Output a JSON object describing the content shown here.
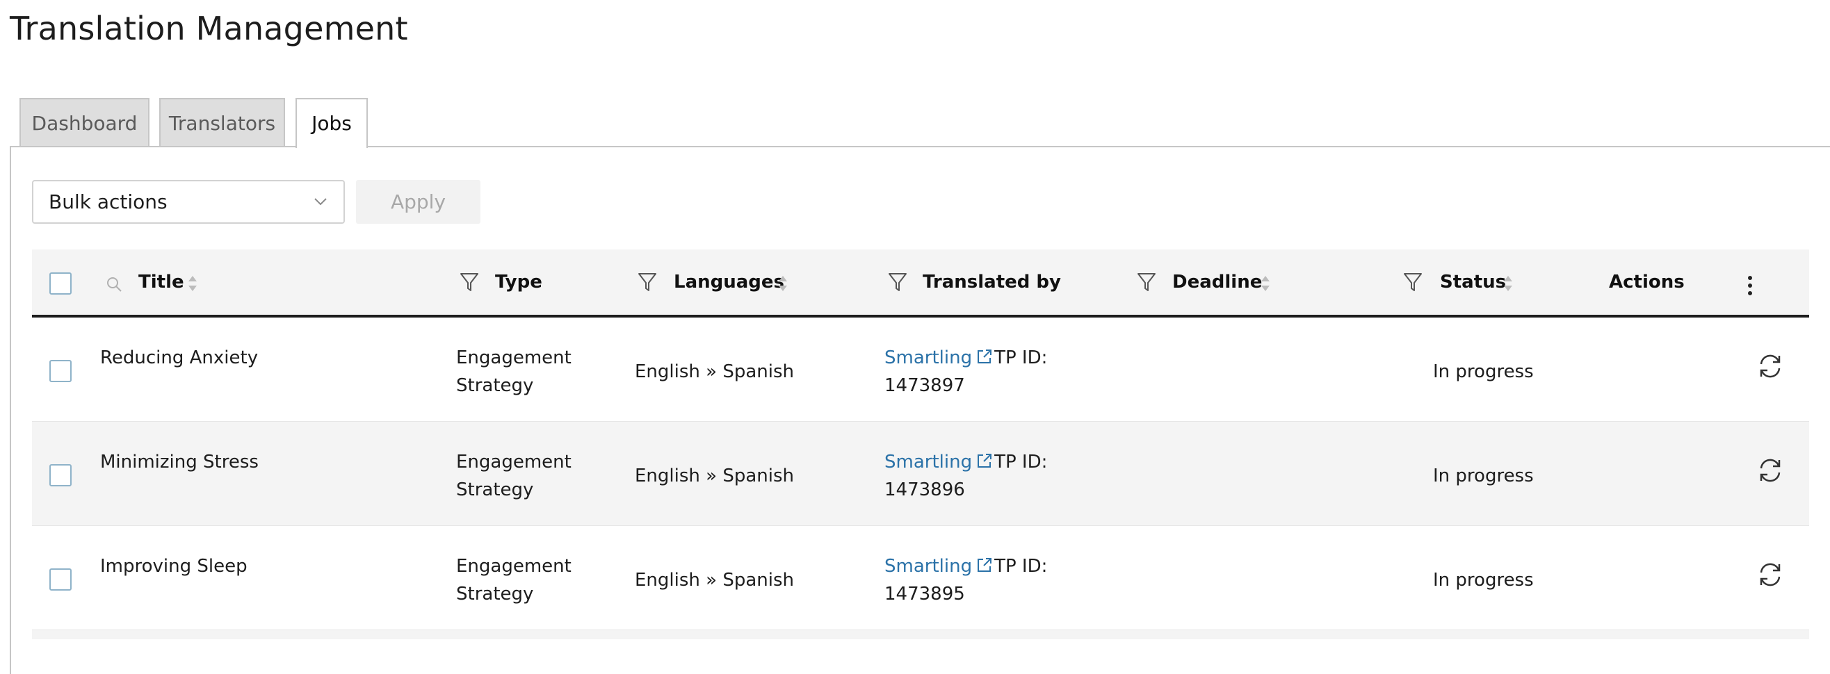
{
  "page": {
    "title": "Translation Management"
  },
  "tabs": [
    {
      "label": "Dashboard"
    },
    {
      "label": "Translators"
    },
    {
      "label": "Jobs"
    }
  ],
  "toolbar": {
    "bulk_actions": "Bulk actions",
    "apply_label": "Apply"
  },
  "table": {
    "columns": {
      "title": "Title",
      "type": "Type",
      "languages": "Languages",
      "translated_by": "Translated by",
      "deadline": "Deadline",
      "status": "Status",
      "actions": "Actions"
    },
    "rows": [
      {
        "title": "Reducing Anxiety",
        "type_line1": "Engagement",
        "type_line2": "Strategy",
        "languages": "English » Spanish",
        "provider": "Smartling",
        "tp_label": "TP ID:",
        "tp_id": "1473897",
        "deadline": "",
        "status": "In progress"
      },
      {
        "title": "Minimizing Stress",
        "type_line1": "Engagement",
        "type_line2": "Strategy",
        "languages": "English » Spanish",
        "provider": "Smartling",
        "tp_label": "TP ID:",
        "tp_id": "1473896",
        "deadline": "",
        "status": "In progress"
      },
      {
        "title": "Improving Sleep",
        "type_line1": "Engagement",
        "type_line2": "Strategy",
        "languages": "English » Spanish",
        "provider": "Smartling",
        "tp_label": "TP ID:",
        "tp_id": "1473895",
        "deadline": "",
        "status": "In progress"
      }
    ]
  },
  "colors": {
    "link": "#2b72a8",
    "header_bg": "#f4f4f4",
    "tab_inactive_bg": "#dedede",
    "checkbox_border": "#8fb3c9"
  },
  "icons": [
    "search-icon",
    "sort-icon",
    "filter-icon",
    "kebab-menu-icon",
    "external-link-icon",
    "refresh-icon",
    "chevron-down-icon"
  ]
}
